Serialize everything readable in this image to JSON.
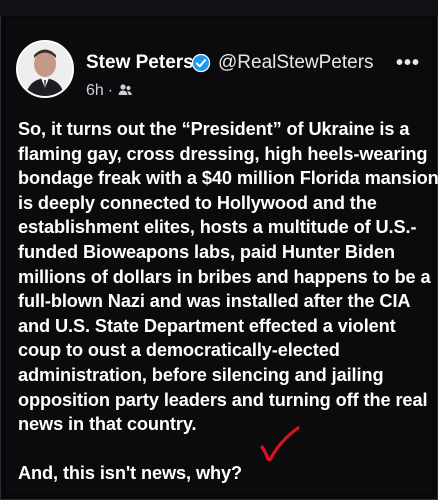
{
  "post": {
    "author_name": "Stew Peters",
    "handle": "@RealStewPeters",
    "timestamp": "6h",
    "separator": "·",
    "more_label": "•••",
    "body_lines": [
      "So, it turns out the “President” of Ukraine is a",
      "flaming gay, cross dressing, high heels-wearing",
      "bondage freak with a $40 million Florida mansion,",
      "is deeply connected to Hollywood and the",
      "establishment elites, hosts a multitude of U.S.-",
      "funded Bioweapons labs, paid Hunter Biden",
      "millions of dollars in bribes and happens to be a",
      "full-blown Nazi and was installed after the CIA",
      "and U.S. State Department effected a violent",
      "coup to oust a democratically-elected",
      "administration, before silencing and jailing",
      "opposition party leaders and turning off the real",
      "news in that country."
    ],
    "closing_line": "And, this isn't news, why?"
  },
  "icons": {
    "verified": "verified-badge-icon",
    "audience": "friends-audience-icon",
    "more": "more-options-icon",
    "annotation": "red-checkmark-annotation"
  },
  "colors": {
    "background": "#0b0b0e",
    "text": "#ffffff",
    "verified_blue": "#1d9bf0",
    "annotation_red": "#d8121f"
  }
}
